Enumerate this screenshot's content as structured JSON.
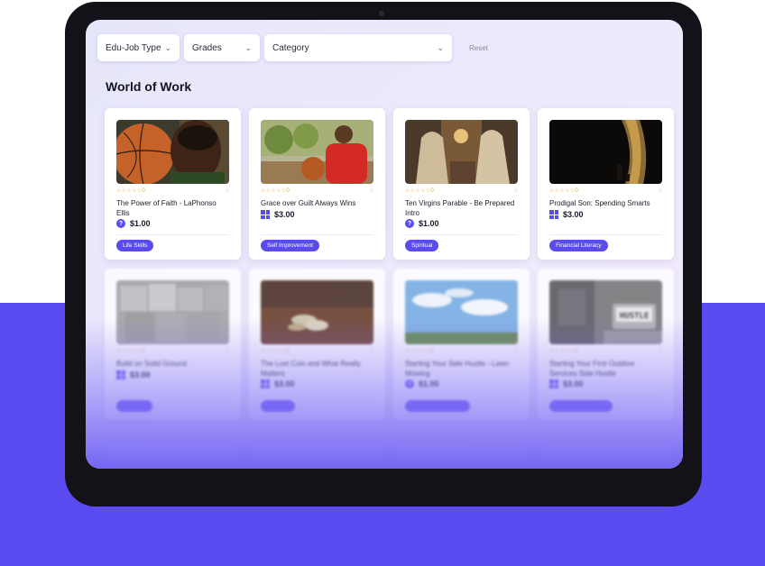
{
  "filters": {
    "edu_job_type": "Edu-Job Type",
    "grades": "Grades",
    "category": "Category",
    "reset": "Reset"
  },
  "section": {
    "title": "World of Work"
  },
  "colors": {
    "accent": "#5a4bf0",
    "star": "#e8a23c",
    "background": "#5a4bf0"
  },
  "cards": [
    {
      "title": "The Power of Faith - LaPhonso Ellis",
      "rating": "☆☆☆☆☆0",
      "price": "$1.00",
      "price_icon": "question-icon",
      "tag": "Life Skills"
    },
    {
      "title": "Grace over Guilt Always Wins",
      "rating": "☆☆☆☆☆0",
      "price": "$3.00",
      "price_icon": "grid-icon",
      "tag": "Self Improvement"
    },
    {
      "title": "Ten Virgins Parable - Be Prepared Intro",
      "rating": "☆☆☆☆☆0",
      "price": "$1.00",
      "price_icon": "question-icon",
      "tag": "Spiritual"
    },
    {
      "title": "Prodigal Son: Spending Smarts",
      "rating": "☆☆☆☆☆0",
      "price": "$3.00",
      "price_icon": "grid-icon",
      "tag": "Financial Literacy"
    },
    {
      "title": "Build on Solid Ground",
      "rating": "☆☆☆☆☆0",
      "price": "$3.00",
      "price_icon": "grid-icon",
      "tag": ""
    },
    {
      "title": "The Lost Coin and What Really Matters",
      "rating": "☆☆☆☆☆0",
      "price": "$3.00",
      "price_icon": "grid-icon",
      "tag": ""
    },
    {
      "title": "Starting Your Side Hustle - Lawn Mowing",
      "rating": "☆☆☆☆☆0",
      "price": "$1.00",
      "price_icon": "question-icon",
      "tag": ""
    },
    {
      "title": "Starting Your First Outdoor Services Side Hustle",
      "rating": "☆☆☆☆☆0",
      "price": "$3.00",
      "price_icon": "grid-icon",
      "tag": ""
    }
  ],
  "images": {
    "hustle_sign": "HUSTLE"
  }
}
